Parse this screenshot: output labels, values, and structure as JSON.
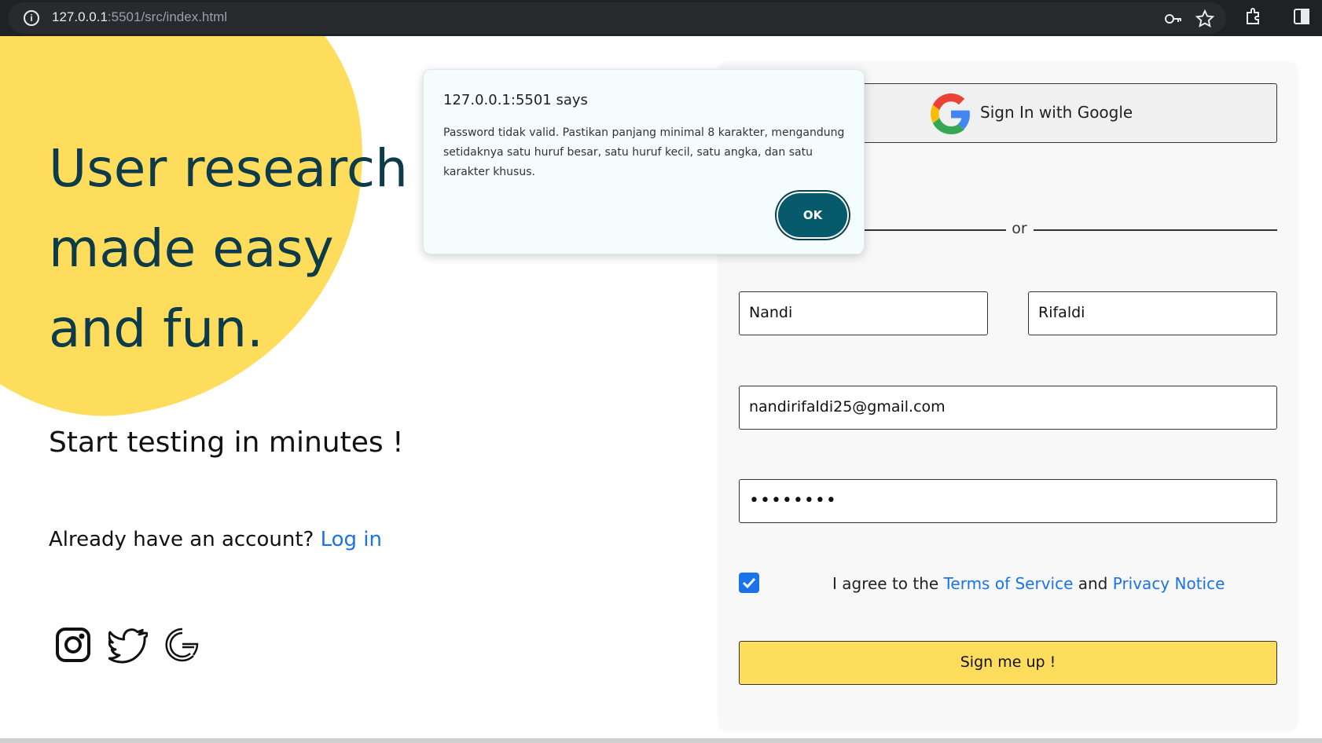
{
  "browser": {
    "url_host": "127.0.0.1",
    "url_rest": ":5501/src/index.html",
    "icons": [
      "info-icon",
      "key-icon",
      "star-icon",
      "extensions-icon",
      "sidepanel-icon"
    ]
  },
  "hero": {
    "headline_line1": "User research",
    "headline_line2": "made easy",
    "headline_line3": "and fun.",
    "subhead": "Start testing in minutes !",
    "already_text": "Already have an account? ",
    "login_link": "Log in",
    "social_icons": [
      "instagram-icon",
      "twitter-icon",
      "google-icon"
    ]
  },
  "form": {
    "google_button_label": "Sign In with Google",
    "or_label": "or",
    "first_name_value": "Nandi",
    "last_name_value": "Rifaldi",
    "email_value": "nandirifaldi25@gmail.com",
    "password_mask": "••••••••",
    "terms_checked": true,
    "agree_prefix": "I agree to the ",
    "terms_link": "Terms of Service",
    "agree_and": " and ",
    "privacy_link": "Privacy Notice",
    "signup_label": "Sign me up !"
  },
  "dialog": {
    "title": "127.0.0.1:5501 says",
    "message": "Password tidak valid. Pastikan panjang minimal 8 karakter, mengandung setidaknya satu huruf besar, satu huruf kecil, satu angka, dan satu karakter khusus.",
    "ok_label": "OK"
  },
  "colors": {
    "accent_yellow": "#ffdd5c",
    "heading_navy": "#0d3b4a",
    "link_blue": "#1a73e8",
    "dialog_button": "#075a6b"
  }
}
